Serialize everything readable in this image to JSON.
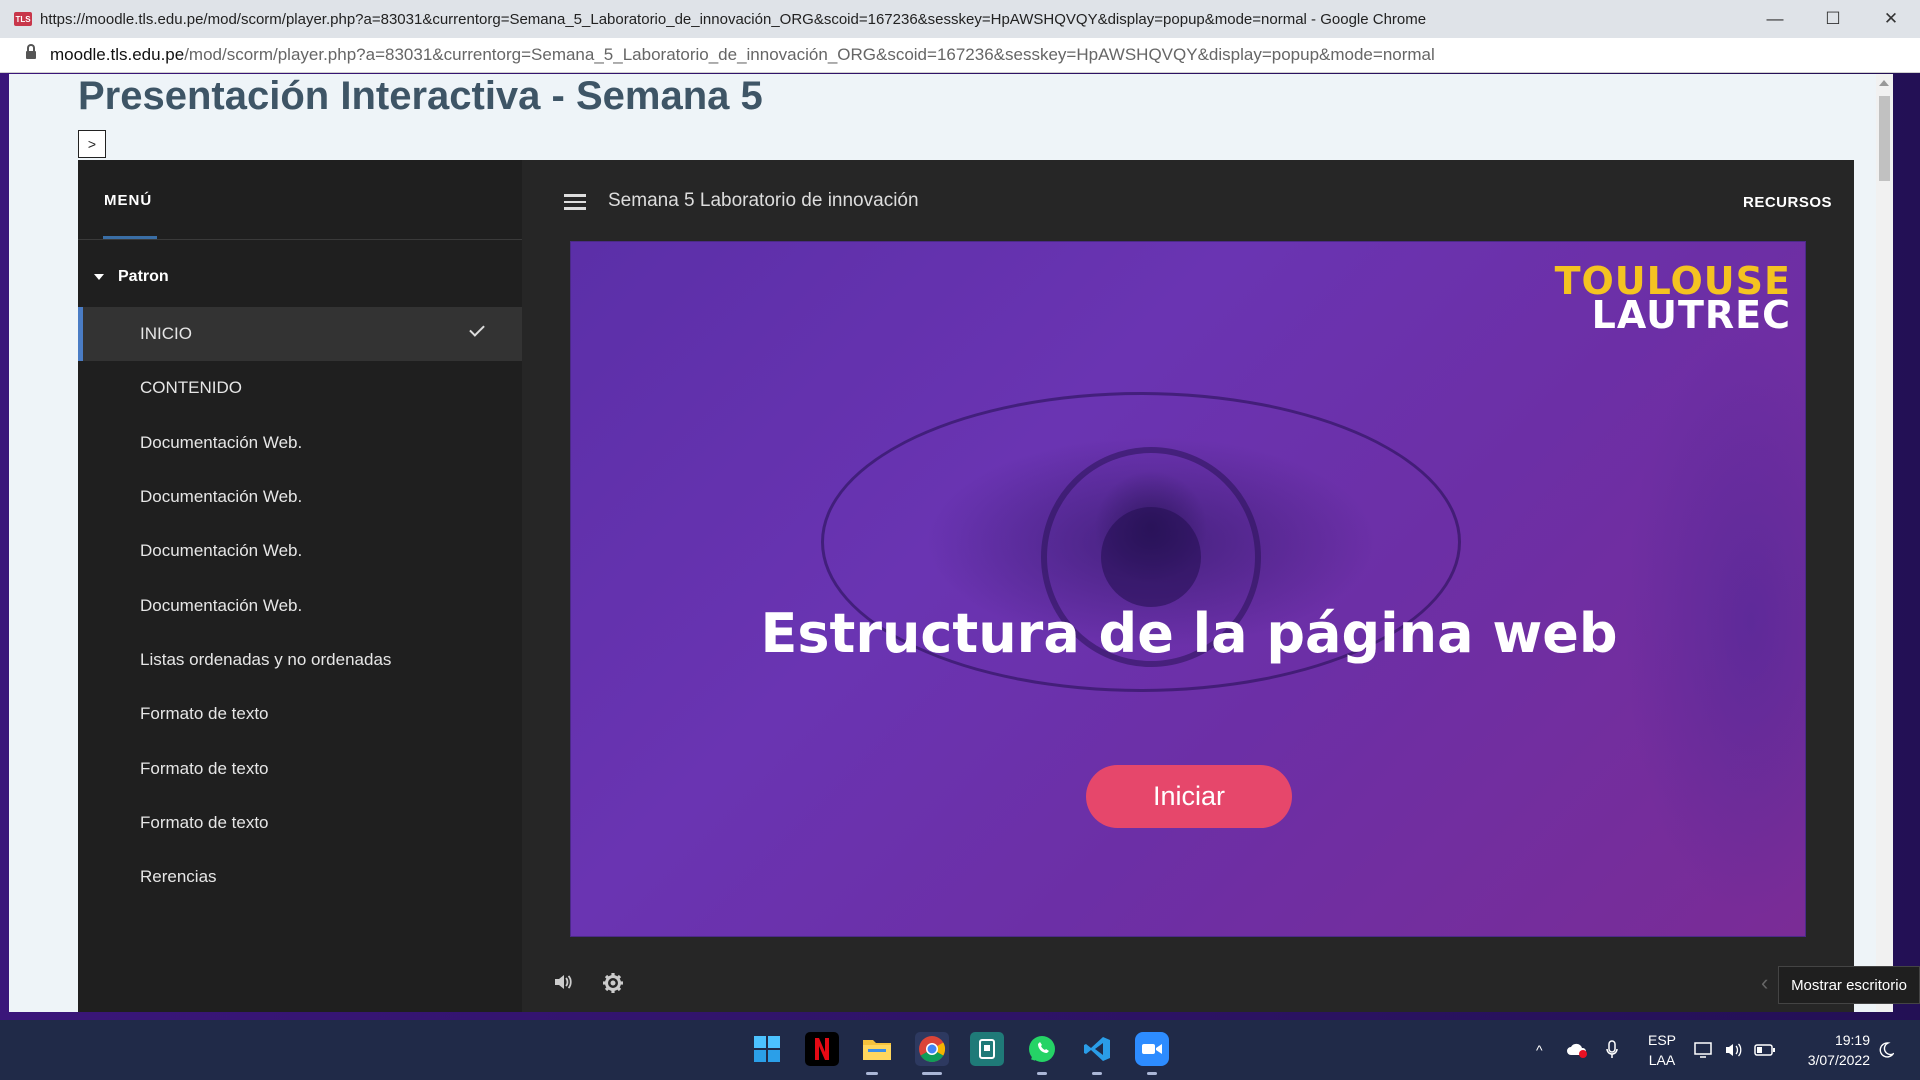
{
  "browser": {
    "window_title": "https://moodle.tls.edu.pe/mod/scorm/player.php?a=83031&currentorg=Semana_5_Laboratorio_de_innovación_ORG&scoid=167236&sesskey=HpAWSHQVQY&display=popup&mode=normal - Google Chrome",
    "favicon_text": "TLS",
    "url_host": "moodle.tls.edu.pe",
    "url_path": "/mod/scorm/player.php?a=83031&currentorg=Semana_5_Laboratorio_de_innovación_ORG&scoid=167236&sesskey=HpAWSHQVQY&display=popup&mode=normal",
    "controls": {
      "minimize": "—",
      "maximize": "☐",
      "close": "✕"
    }
  },
  "page": {
    "title": "Presentación Interactiva - Semana 5",
    "toggle_label": ">"
  },
  "player": {
    "menu_tab": "MENÚ",
    "section": "Patron",
    "course_title": "Semana 5 Laboratorio de innovación",
    "resources_label": "RECURSOS",
    "nav_items": [
      {
        "label": "INICIO",
        "active": true,
        "completed": true
      },
      {
        "label": "CONTENIDO"
      },
      {
        "label": "Documentación Web."
      },
      {
        "label": "Documentación Web."
      },
      {
        "label": "Documentación Web."
      },
      {
        "label": "Documentación Web."
      },
      {
        "label": "Listas ordenadas y no ordenadas"
      },
      {
        "label": "Formato de texto"
      },
      {
        "label": "Formato de texto"
      },
      {
        "label": "Formato de texto"
      },
      {
        "label": "Rerencias"
      }
    ],
    "slide": {
      "brand_line1": "TOULOUSE",
      "brand_line2": "LAUTREC",
      "heading": "Estructura de la página web",
      "start_button": "Iniciar"
    },
    "prev_arrow": "‹"
  },
  "tooltip": "Mostrar escritorio",
  "taskbar": {
    "apps": [
      "windows-start",
      "netflix",
      "file-explorer",
      "chrome",
      "tasks-app",
      "whatsapp",
      "vscode",
      "zoom"
    ],
    "language_line1": "ESP",
    "language_line2": "LAA",
    "time": "19:19",
    "date": "3/07/2022",
    "tray_chevron": "^"
  },
  "colors": {
    "accent_blue": "#4a7cc4",
    "brand_yellow": "#f4c321",
    "start_button": "#e6476b",
    "slide_purple": "#6a34b2",
    "player_bg": "#262626"
  }
}
